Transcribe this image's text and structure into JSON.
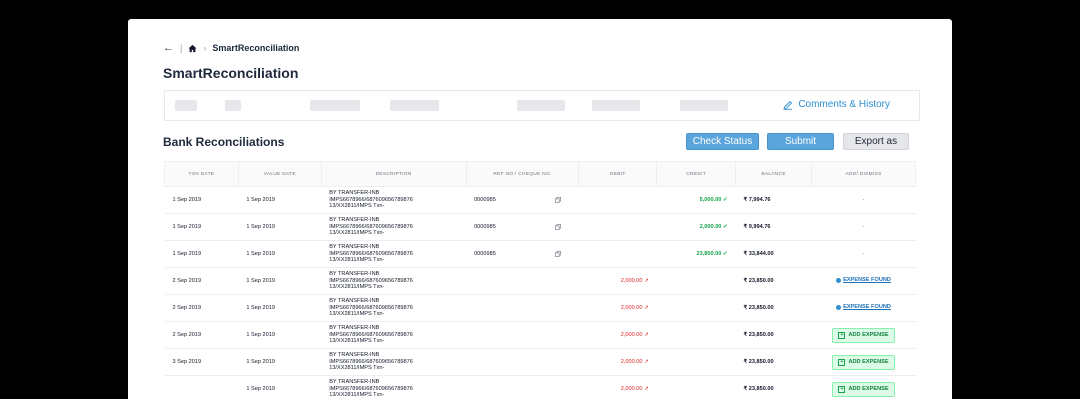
{
  "breadcrumb": {
    "current": "SmartReconciliation"
  },
  "page": {
    "title": "SmartReconciliation"
  },
  "info_bar": {
    "comments_label": "Comments & History"
  },
  "section": {
    "title": "Bank Reconciliations"
  },
  "toolbar": {
    "check_status": "Check Status",
    "submit": "Submit",
    "export": "Export as"
  },
  "table": {
    "columns": [
      "TXN DATE",
      "VALUE DATE",
      "DESCRIPTION",
      "REF NO./ CHEQUE NO.",
      "DEBIT",
      "CREDIT",
      "BALANCE",
      "ADD/ DISMISS"
    ],
    "rows": [
      {
        "txn_date": "1 Sep 2019",
        "value_date": "1 Sep 2019",
        "desc1": "BY TRANSFER-INB",
        "desc2": "IMPS6678966/687609656789876",
        "desc3": "13/XX2811/IMPS Txn-",
        "ref": "0000985",
        "debit": "",
        "credit": "5,000.00 ✓",
        "balance": "₹ 7,994.76",
        "action": "-"
      },
      {
        "txn_date": "1 Sep 2019",
        "value_date": "1 Sep 2019",
        "desc1": "BY TRANSFER-INB",
        "desc2": "IMPS6678966/687609656789876",
        "desc3": "13/XX2811/IMPS Txn-",
        "ref": "0000985",
        "debit": "",
        "credit": "2,000.00 ✓",
        "balance": "₹ 9,994.76",
        "action": "-"
      },
      {
        "txn_date": "1 Sep 2019",
        "value_date": "1 Sep 2019",
        "desc1": "BY TRANSFER-INB",
        "desc2": "IMPS6678966/687609656789876",
        "desc3": "13/XX2811/IMPS Txn-",
        "ref": "0000985",
        "debit": "",
        "credit": "23,850.00 ✓",
        "balance": "₹ 33,844.00",
        "action": "-"
      },
      {
        "txn_date": "2 Sep 2019",
        "value_date": "1 Sep 2019",
        "desc1": "BY TRANSFER-INB",
        "desc2": "IMPS6678966/687609656789876",
        "desc3": "13/XX2811/IMPS Txn-",
        "ref": "",
        "debit": "2,000.00 ↗",
        "credit": "",
        "balance": "₹ 23,850.00",
        "action": "EXPENSE FOUND"
      },
      {
        "txn_date": "2 Sep 2019",
        "value_date": "1 Sep 2019",
        "desc1": "BY TRANSFER-INB",
        "desc2": "IMPS6678966/687609656789876",
        "desc3": "13/XX2811/IMPS Txn-",
        "ref": "",
        "debit": "2,000.00 ↗",
        "credit": "",
        "balance": "₹ 23,850.00",
        "action": "EXPENSE FOUND"
      },
      {
        "txn_date": "2 Sep 2019",
        "value_date": "1 Sep 2019",
        "desc1": "BY TRANSFER-INB",
        "desc2": "IMPS6678966/687609656789876",
        "desc3": "13/XX2811/IMPS Txn-",
        "ref": "",
        "debit": "2,000.00 ↗",
        "credit": "",
        "balance": "₹ 23,850.00",
        "action": "ADD EXPENSE"
      },
      {
        "txn_date": "3 Sep 2019",
        "value_date": "1 Sep 2019",
        "desc1": "BY TRANSFER-INB",
        "desc2": "IMPS6678966/687609656789876",
        "desc3": "13/XX2811/IMPS Txn-",
        "ref": "",
        "debit": "2,000.00 ↗",
        "credit": "",
        "balance": "₹ 23,850.00",
        "action": "ADD EXPENSE"
      },
      {
        "txn_date": "",
        "value_date": "1 Sep 2019",
        "desc1": "BY TRANSFER-INB",
        "desc2": "IMPS6678966/687609656789876",
        "desc3": "13/XX2811/IMPS Txn-",
        "ref": "",
        "debit": "2,000.00 ↗",
        "credit": "",
        "balance": "₹ 23,850.00",
        "action": "ADD EXPENSE"
      }
    ]
  },
  "colors": {
    "accent": "#5aa5db",
    "link": "#2f8fd1",
    "debit": "#dc2626",
    "credit": "#16a34a"
  }
}
